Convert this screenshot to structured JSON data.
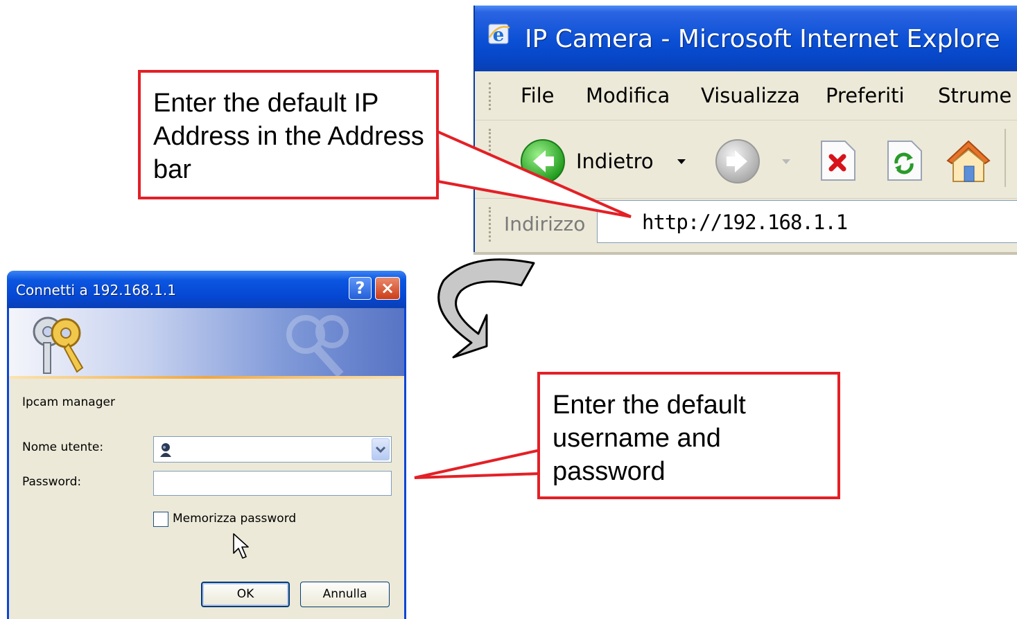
{
  "browser": {
    "title": "IP Camera - Microsoft Internet Explore",
    "menu": [
      "File",
      "Modifica",
      "Visualizza",
      "Preferiti",
      "Strume"
    ],
    "toolbar": {
      "back_label": "Indietro"
    },
    "address": {
      "label": "Indirizzo",
      "value": "http://192.168.1.1"
    }
  },
  "dialog": {
    "title": "Connetti a 192.168.1.1",
    "help_symbol": "?",
    "close_symbol": "×",
    "realm": "Ipcam manager",
    "username_label": "Nome utente:",
    "username_value": "",
    "password_label": "Password:",
    "password_value": "",
    "remember_label": "Memorizza password",
    "remember_checked": false,
    "ok_label": "OK",
    "cancel_label": "Annulla"
  },
  "callouts": {
    "address_hint": "Enter the default IP Address in the Address bar",
    "login_hint": "Enter the default username and password"
  },
  "colors": {
    "callout_border": "#e32026",
    "xp_blue": "#0a4fd4",
    "xp_face": "#ece9d8"
  },
  "icons": {
    "browser": "ie-logo-icon",
    "back": "back-arrow-icon",
    "forward": "forward-arrow-icon",
    "stop": "stop-icon",
    "refresh": "refresh-icon",
    "home": "home-icon",
    "dialog_keys": "keys-icon",
    "user": "user-icon",
    "cursor": "mouse-cursor-icon",
    "curved_arrow": "curved-arrow-icon"
  }
}
